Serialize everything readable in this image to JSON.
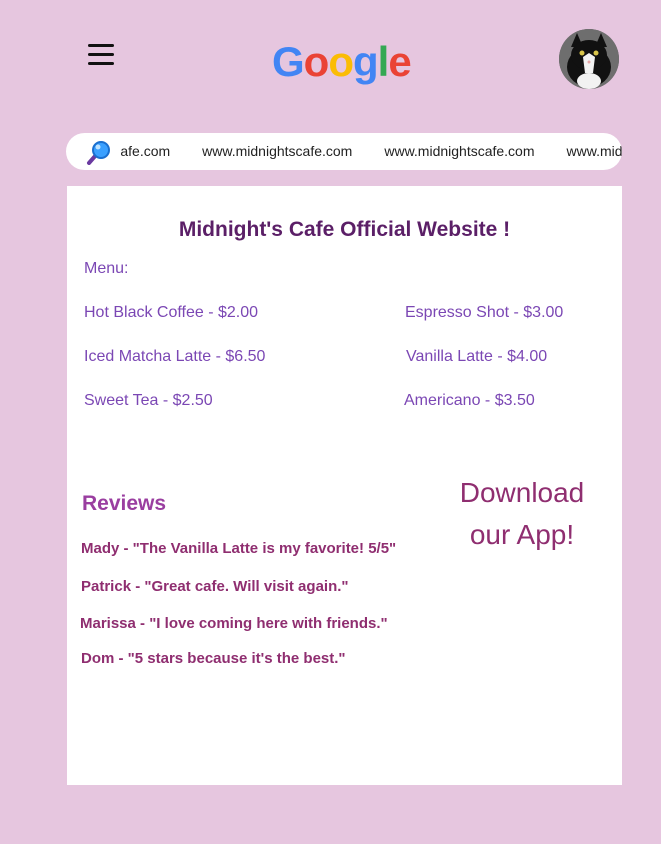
{
  "header": {
    "menu_icon": "hamburger-menu-icon",
    "logo_letters": [
      "G",
      "o",
      "o",
      "g",
      "l",
      "e"
    ],
    "logo_colors": [
      "#4285F4",
      "#EA4335",
      "#FBBC05",
      "#4285F4",
      "#34A853",
      "#EA4335"
    ],
    "avatar_icon": "profile-photo-cat"
  },
  "search": {
    "icon": "magnifying-glass-icon",
    "urls": [
      "www.midnightscafe.com",
      "www.midnightscafe.com",
      "www.midnightscafe.com",
      "www.midnightscafe.com"
    ]
  },
  "page": {
    "title": "Midnight's Cafe Official Website !",
    "menu_label": "Menu:",
    "menu_items": [
      "Hot Black Coffee - $2.00",
      "Espresso Shot - $3.00",
      "Iced Matcha Latte - $6.50",
      "Vanilla Latte - $4.00",
      "Sweet Tea - $2.50",
      "Americano - $3.50"
    ],
    "reviews_heading": "Reviews",
    "reviews": [
      "Mady - \"The Vanilla Latte is my favorite! 5/5\"",
      "Patrick - \"Great cafe. Will visit again.\"",
      "Marissa - \"I love coming here with friends.\"",
      "Dom - \"5 stars because it's the best.\""
    ],
    "download_line1": "Download",
    "download_line2": "our App!"
  },
  "colors": {
    "background": "#e6c6df",
    "title": "#5b1f67",
    "menu_text": "#7b47b4",
    "reviews_heading": "#9a3ea0",
    "review_text": "#8f2e70"
  }
}
